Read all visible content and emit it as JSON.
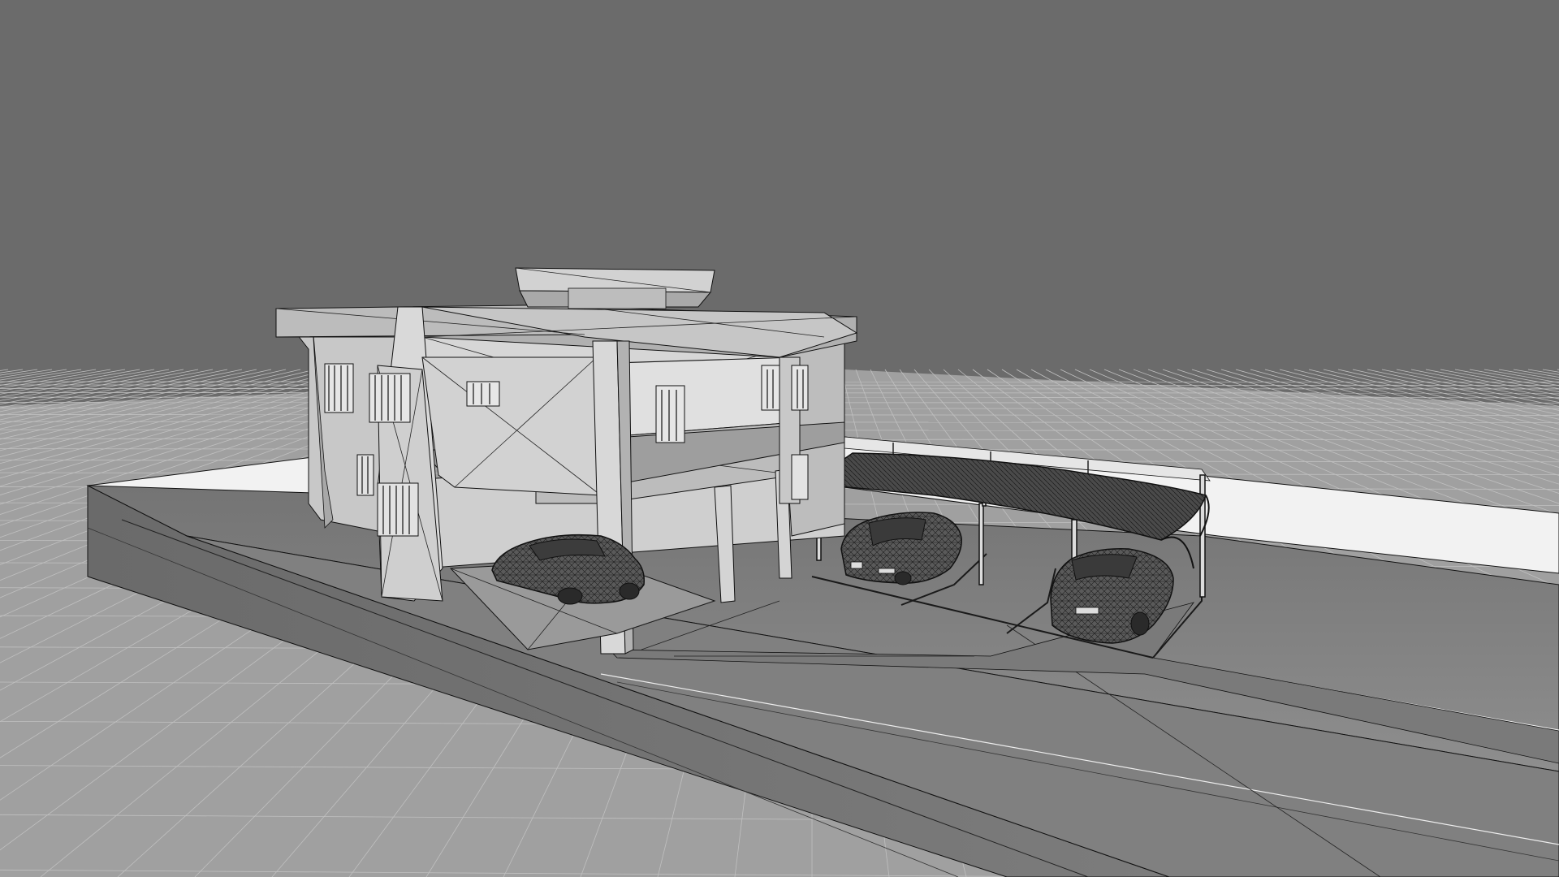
{
  "viewport": {
    "mode": "wireframe-on-shaded",
    "colors": {
      "background": "#6b6b6b",
      "grid_plane": "#a3a3a3",
      "grid_line": "#c4c4c4",
      "building_light": "#d4d4d4",
      "building_mid": "#b8b8b8",
      "building_dark": "#8a8a8a",
      "ground_slab": "#707070",
      "boundary_wall": "#f0f0f0",
      "edge": "#111111",
      "car_body": "#4a4a4a",
      "carport_roof": "#3a3a3a"
    }
  },
  "scene": {
    "objects": [
      {
        "name": "ground-grid"
      },
      {
        "name": "site-slab"
      },
      {
        "name": "boundary-wall"
      },
      {
        "name": "house"
      },
      {
        "name": "carport-canopy"
      },
      {
        "name": "car-under-house"
      },
      {
        "name": "car-carport-left"
      },
      {
        "name": "car-carport-right"
      },
      {
        "name": "parking-lines"
      }
    ]
  }
}
